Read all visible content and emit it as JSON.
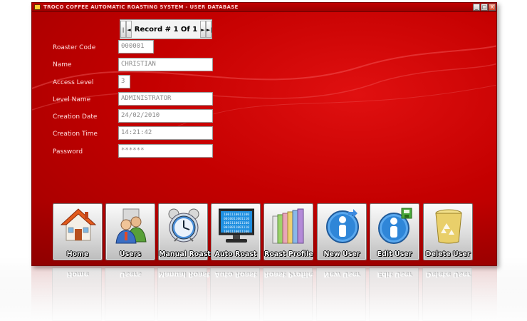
{
  "window": {
    "title": "TROCO COFFEE AUTOMATIC ROASTING SYSTEM - USER DATABASE",
    "controls": {
      "minimize": "_",
      "maximize": "□",
      "close": "X"
    }
  },
  "record_nav": {
    "first": "|◄",
    "prev": "◄",
    "label": "Record # 1 Of 1",
    "next": "►",
    "last": "►|"
  },
  "form": {
    "fields": [
      {
        "label": "Roaster Code",
        "value": "000001"
      },
      {
        "label": "Name",
        "value": "CHRISTIAN"
      },
      {
        "label": "Access Level",
        "value": "3"
      },
      {
        "label": "Level Name",
        "value": "ADMINISTRATOR"
      },
      {
        "label": "Creation Date",
        "value": "24/02/2010"
      },
      {
        "label": "Creation Time",
        "value": "14:21:42"
      },
      {
        "label": "Password",
        "value": "******"
      }
    ]
  },
  "toolbar": {
    "buttons": [
      {
        "label": "Home",
        "icon": "house-icon"
      },
      {
        "label": "Users",
        "icon": "users-icon"
      },
      {
        "label": "Manual Roast",
        "icon": "alarm-clock-icon"
      },
      {
        "label": "Auto Roast",
        "icon": "binary-monitor-icon"
      },
      {
        "label": "Roast Profile",
        "icon": "books-icon"
      },
      {
        "label": "New User",
        "icon": "new-user-icon"
      },
      {
        "label": "Edit User",
        "icon": "edit-user-icon"
      },
      {
        "label": "Delete User",
        "icon": "recycle-bin-icon"
      }
    ],
    "monitor_text": [
      "1001110011100",
      "0010011001110",
      "1001110011100",
      "0010011001110",
      "1001110011100"
    ]
  }
}
